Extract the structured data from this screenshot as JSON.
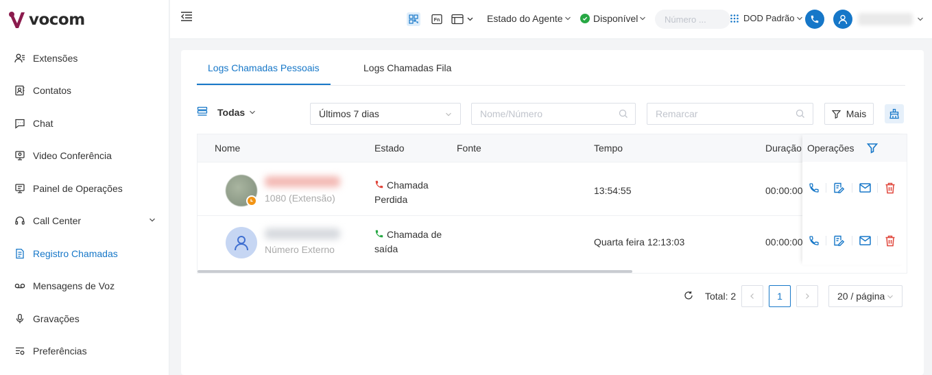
{
  "brand": {
    "name": "vocom",
    "accent": "#1677c8",
    "logo_color": "#8b1b4d"
  },
  "sidebar": {
    "items": [
      {
        "label": "Extensões",
        "icon": "extensions-icon"
      },
      {
        "label": "Contatos",
        "icon": "contacts-icon"
      },
      {
        "label": "Chat",
        "icon": "chat-icon"
      },
      {
        "label": "Video Conferência",
        "icon": "video-conference-icon"
      },
      {
        "label": "Painel de Operações",
        "icon": "operations-panel-icon"
      },
      {
        "label": "Call Center",
        "icon": "headset-icon"
      },
      {
        "label": "Registro Chamadas",
        "icon": "call-log-icon",
        "active": true
      },
      {
        "label": "Mensagens de Voz",
        "icon": "voicemail-icon"
      },
      {
        "label": "Gravações",
        "icon": "microphone-icon"
      },
      {
        "label": "Preferências",
        "icon": "preferences-icon"
      }
    ]
  },
  "header": {
    "agent_state_label": "Estado do Agente",
    "status_label": "Disponível",
    "status_color": "#27a844",
    "number_placeholder": "Número ...",
    "dod_label": "DOD Padrão"
  },
  "tabs": [
    {
      "label": "Logs Chamadas Pessoais",
      "active": true
    },
    {
      "label": "Logs Chamadas Fila",
      "active": false
    }
  ],
  "filters": {
    "scope_label": "Todas",
    "period_value": "Últimos 7 dias",
    "name_placeholder": "Nome/Número",
    "remark_placeholder": "Remarcar",
    "more_label": "Mais"
  },
  "table": {
    "columns": [
      "Nome",
      "Estado",
      "Fonte",
      "Tempo",
      "Duração",
      "Operações"
    ],
    "rows": [
      {
        "subtitle": "1080 (Extensão)",
        "status": "Chamada Perdida",
        "status_color": "#e0453a",
        "source": "",
        "time": "13:54:55",
        "duration": "00:00:00"
      },
      {
        "subtitle": "Número Externo",
        "status": "Chamada de saída",
        "status_color": "#27a844",
        "source": "",
        "time": "Quarta feira 12:13:03",
        "duration": "00:00:00"
      }
    ]
  },
  "pagination": {
    "total_label": "Total: 2",
    "current_page": "1",
    "per_page": "20 / página"
  }
}
